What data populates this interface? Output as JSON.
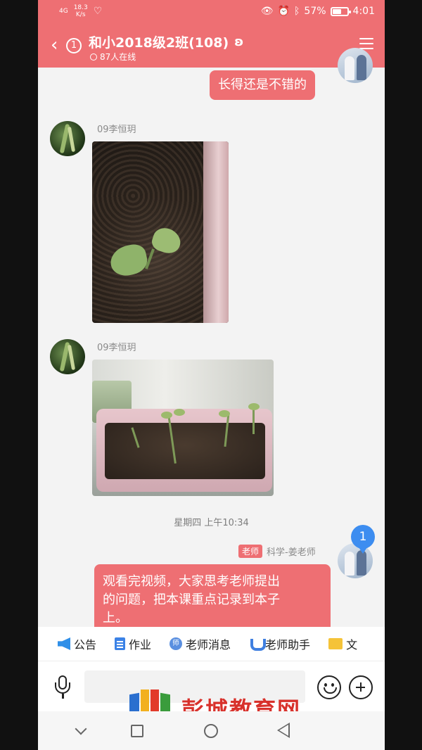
{
  "status_bar": {
    "network": "4G",
    "speed_value": "18.3",
    "speed_unit": "K/s",
    "battery": "57%",
    "battery_level": 0.57,
    "time": "4:01"
  },
  "header": {
    "unread_count": "1",
    "title": "和小2018级2班(108)",
    "online": "87人在线"
  },
  "messages": [
    {
      "type": "text",
      "side": "me",
      "text": "长得还是不错的"
    },
    {
      "type": "image",
      "side": "other",
      "sender": "09李恒玥"
    },
    {
      "type": "image",
      "side": "other",
      "sender": "09李恒玥"
    },
    {
      "type": "timestamp",
      "text": "星期四 上午10:34"
    },
    {
      "type": "text",
      "side": "me",
      "role_badge": "老师",
      "sender": "科学-姜老师",
      "lines": [
        "观看完视频，大家思考老师提出",
        "的问题，把本课重点记录到本子",
        "上。"
      ]
    }
  ],
  "floating_badge": "1",
  "toolbar": [
    {
      "label": "公告",
      "icon": "megaphone-icon"
    },
    {
      "label": "作业",
      "icon": "document-icon"
    },
    {
      "label": "老师消息",
      "icon": "teacher-message-icon"
    },
    {
      "label": "老师助手",
      "icon": "magnet-icon"
    },
    {
      "label": "文",
      "icon": "folder-icon"
    }
  ],
  "watermark": "彭城教育网",
  "colors": {
    "accent": "#ee6f73",
    "badge_blue": "#3d8df0"
  }
}
